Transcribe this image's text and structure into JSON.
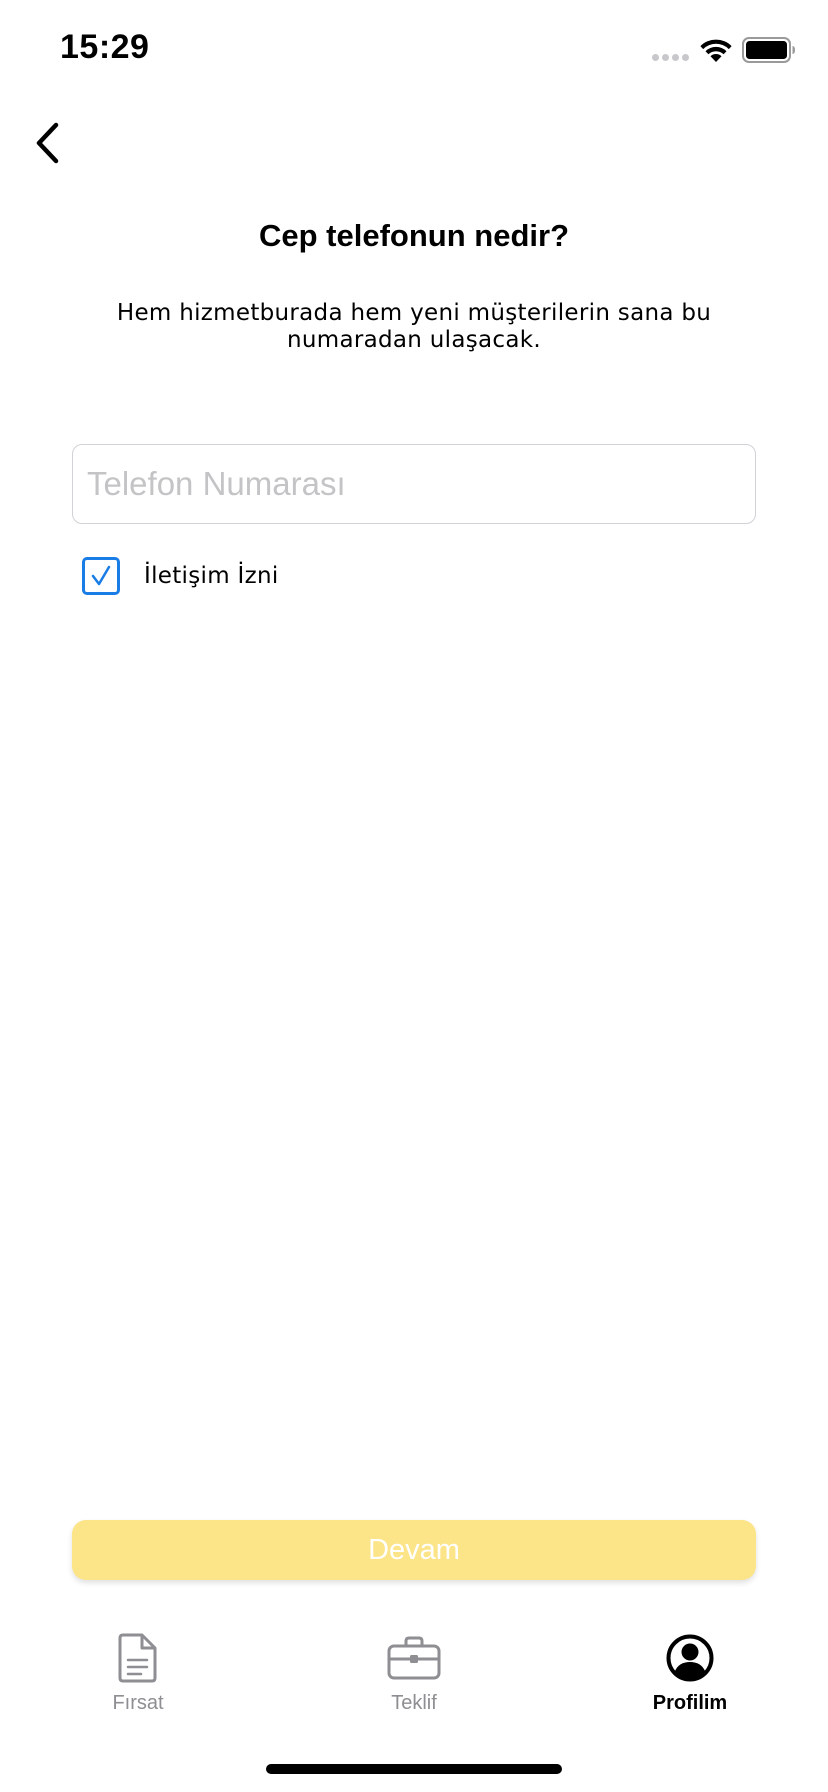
{
  "status_bar": {
    "time": "15:29"
  },
  "header": {
    "back_icon": "chevron-left-icon"
  },
  "main": {
    "title": "Cep telefonun nedir?",
    "subtitle": "Hem hizmetburada hem yeni müşterilerin sana bu numaradan ulaşacak.",
    "phone_input": {
      "value": "",
      "placeholder": "Telefon Numarası"
    },
    "consent": {
      "label": "İletişim İzni",
      "checked": true
    },
    "continue_label": "Devam"
  },
  "tabs": [
    {
      "label": "Fırsat",
      "icon": "document-icon",
      "active": false
    },
    {
      "label": "Teklif",
      "icon": "briefcase-icon",
      "active": false
    },
    {
      "label": "Profilim",
      "icon": "profile-icon",
      "active": true
    }
  ],
  "colors": {
    "accent_yellow": "#fce488",
    "checkbox_blue": "#1a7de6",
    "tab_inactive": "#8e8e93",
    "tab_active": "#000000"
  }
}
